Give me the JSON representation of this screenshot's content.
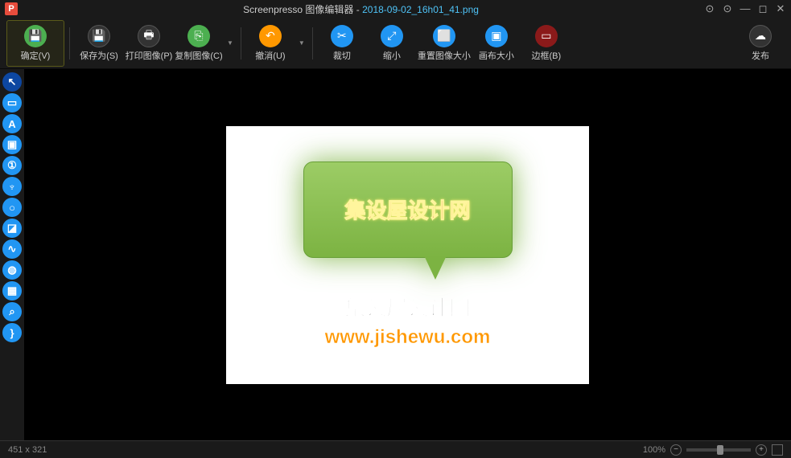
{
  "title": {
    "app": "Screenpresso 图像编辑器",
    "sep": " - ",
    "file": "2018-09-02_16h01_41.png"
  },
  "toolbar": {
    "confirm": "确定(V)",
    "saveAs": "保存为(S)",
    "print": "打印图像(P)",
    "copy": "复制图像(C)",
    "undo": "撤消(U)",
    "crop": "裁切",
    "resize": "缩小",
    "resetSize": "重置图像大小",
    "canvasSize": "画布大小",
    "border": "边框(B)",
    "publish": "发布"
  },
  "canvas": {
    "speech": "集设屋设计网",
    "text1": "集设屋设计网",
    "text2": "www.jishewu.com"
  },
  "status": {
    "dims": "451 x 321",
    "zoom": "100%"
  }
}
